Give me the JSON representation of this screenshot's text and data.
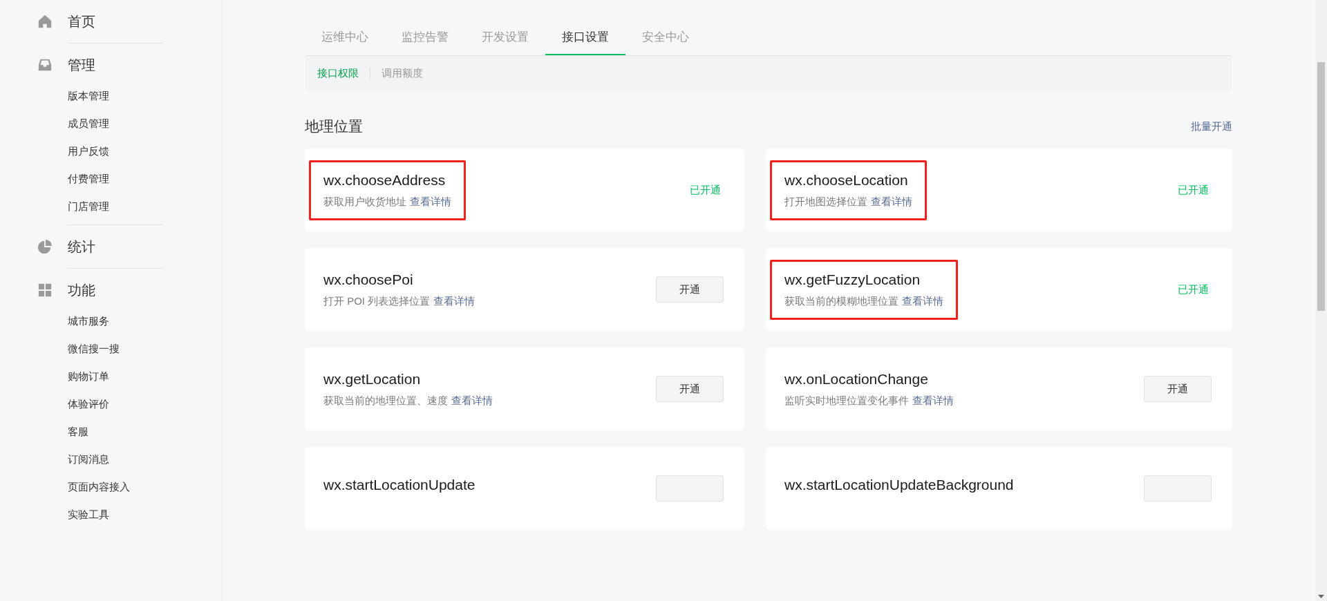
{
  "sidebar": {
    "groups": [
      {
        "label": "首页"
      },
      {
        "label": "管理",
        "items": [
          "版本管理",
          "成员管理",
          "用户反馈",
          "付费管理",
          "门店管理"
        ]
      },
      {
        "label": "统计"
      },
      {
        "label": "功能",
        "items": [
          "城市服务",
          "微信搜一搜",
          "购物订单",
          "体验评价",
          "客服",
          "订阅消息",
          "页面内容接入",
          "实验工具"
        ]
      }
    ]
  },
  "tabs": [
    {
      "label": "运维中心",
      "selected": false
    },
    {
      "label": "监控告警",
      "selected": false
    },
    {
      "label": "开发设置",
      "selected": false
    },
    {
      "label": "接口设置",
      "selected": true
    },
    {
      "label": "安全中心",
      "selected": false
    }
  ],
  "subtabs": [
    {
      "label": "接口权限",
      "selected": true
    },
    {
      "label": "调用额度",
      "selected": false
    }
  ],
  "section": {
    "title": "地理位置",
    "batch_link": "批量开通"
  },
  "apis": [
    {
      "name": "wx.chooseAddress",
      "description": "获取用户收货地址",
      "link": "查看详情",
      "action": {
        "kind": "status",
        "label": "已开通"
      },
      "highlighted": true
    },
    {
      "name": "wx.chooseLocation",
      "description": "打开地图选择位置",
      "link": "查看详情",
      "action": {
        "kind": "status",
        "label": "已开通"
      },
      "highlighted": true
    },
    {
      "name": "wx.choosePoi",
      "description": "打开 POI 列表选择位置",
      "link": "查看详情",
      "action": {
        "kind": "button",
        "label": "开通"
      },
      "highlighted": false
    },
    {
      "name": "wx.getFuzzyLocation",
      "description": "获取当前的模糊地理位置",
      "link": "查看详情",
      "action": {
        "kind": "status",
        "label": "已开通"
      },
      "highlighted": true
    },
    {
      "name": "wx.getLocation",
      "description": "获取当前的地理位置、速度",
      "link": "查看详情",
      "action": {
        "kind": "button",
        "label": "开通"
      },
      "highlighted": false
    },
    {
      "name": "wx.onLocationChange",
      "description": "监听实时地理位置变化事件",
      "link": "查看详情",
      "action": {
        "kind": "button",
        "label": "开通"
      },
      "highlighted": false
    },
    {
      "name": "wx.startLocationUpdate",
      "action": {
        "kind": "button"
      },
      "highlighted": false
    },
    {
      "name": "wx.startLocationUpdateBackground",
      "action": {
        "kind": "button"
      },
      "highlighted": false
    }
  ]
}
